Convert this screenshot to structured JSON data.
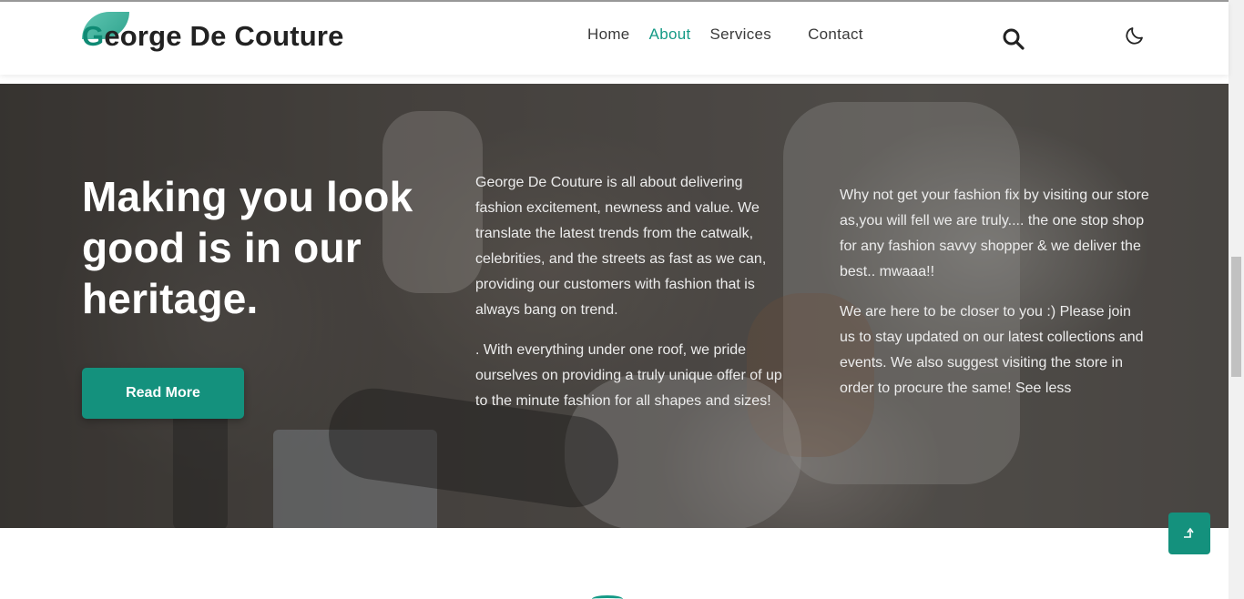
{
  "header": {
    "logo_first_letter": "G",
    "logo_rest": "eorge De Couture",
    "nav": [
      {
        "label": "Home"
      },
      {
        "label": "About"
      },
      {
        "label": "Services"
      },
      {
        "label": "Contact"
      }
    ],
    "active_nav": "About"
  },
  "hero": {
    "title": "Making you look good is in our heritage.",
    "button_label": "Read More",
    "col1": {
      "p1": "George De Couture is all about delivering fashion excitement, newness and value. We translate the latest trends from the catwalk, celebrities, and the streets as fast as we can, providing our customers with fashion that is always bang on trend.",
      "p2": ". With everything under one roof, we pride ourselves on providing a truly unique offer of up to the minute fashion for all shapes and sizes!"
    },
    "col2": {
      "p1": "Why not get your fashion fix by visiting our store as,you will fell we are truly.... the one stop shop for any fashion savvy shopper & we deliver the best.. mwaaa!!",
      "p2": "We are here to be closer to you :) Please join us to stay updated on our latest collections and events. We also suggest visiting the store in order to procure the same! See less"
    }
  },
  "icons": {
    "search": "search-icon",
    "theme": "moon-icon",
    "scroll_top": "arrow-up-icon"
  },
  "colors": {
    "accent": "#14917d",
    "nav_active": "#159a86"
  }
}
